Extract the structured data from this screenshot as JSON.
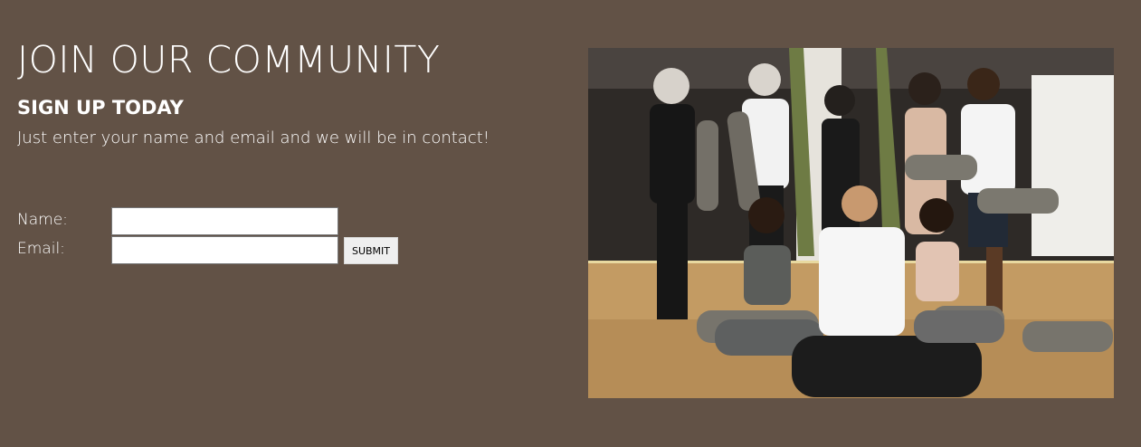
{
  "signup": {
    "title": "JOIN OUR COMMUNITY",
    "subtitle": "SIGN UP TODAY",
    "description": "Just enter your name and email and we will be in contact!"
  },
  "form": {
    "name_label": "Name:",
    "name_value": "",
    "email_label": "Email:",
    "email_value": "",
    "submit_label": "SUBMIT"
  },
  "image": {
    "alt": "Group of smiling people with yoga mats in a studio"
  },
  "colors": {
    "background": "#625246",
    "text": "#ffffff"
  }
}
